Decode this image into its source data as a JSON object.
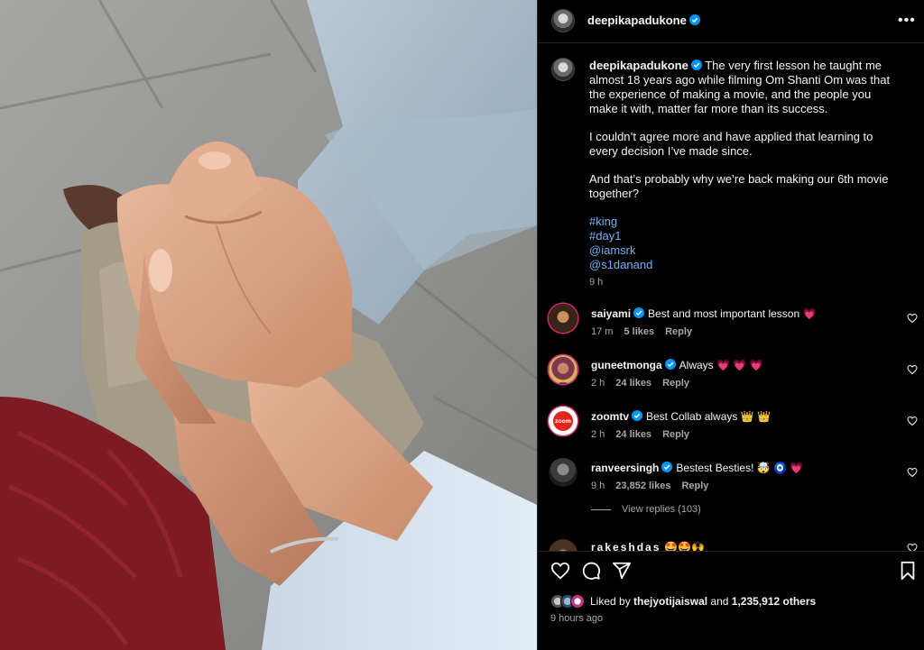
{
  "post": {
    "author": "deepikapadukone",
    "more_icon": "more-horizontal-icon",
    "caption": {
      "paragraphs": [
        "The very first lesson he taught me almost 18 years ago while filming Om Shanti Om was that the experience of making a movie, and the people you make it with, matter far more than its success.",
        "I couldn’t agree more and have applied that learning to every decision I’ve made since.",
        "And that’s probably why we’re back making our 6th movie together?"
      ],
      "tags": [
        "#king",
        "#day1",
        "@iamsrk",
        "@s1danand"
      ],
      "time": "9 h"
    }
  },
  "comments": [
    {
      "user": "saiyami",
      "text": "Best and most important lesson 💗",
      "time": "17 m",
      "likes": "5 likes",
      "reply": "Reply"
    },
    {
      "user": "guneetmonga",
      "text": "Always 💗 💗 💗",
      "time": "2 h",
      "likes": "24 likes",
      "reply": "Reply"
    },
    {
      "user": "zoomtv",
      "text": "Best Collab always 👑 👑",
      "time": "2 h",
      "likes": "24 likes",
      "reply": "Reply"
    },
    {
      "user": "ranveersingh",
      "text": "Bestest Besties! 🤯 🧿 💗",
      "time": "9 h",
      "likes": "23,852 likes",
      "reply": "Reply"
    }
  ],
  "view_replies": "View replies (103)",
  "partial_comment": {
    "user": "rakeshdas",
    "text": "🤩🤩🙌"
  },
  "zoom_logo_text": "zoom",
  "likes": {
    "prefix": "Liked by",
    "user": "thejyotijaiswal",
    "and": "and",
    "count": "1,235,912 others"
  },
  "posted": "9 hours ago",
  "colors": {
    "link": "#6cb4f5",
    "verified": "#0095f6",
    "heart": "#ed4956",
    "muted": "#a8a8a8"
  }
}
